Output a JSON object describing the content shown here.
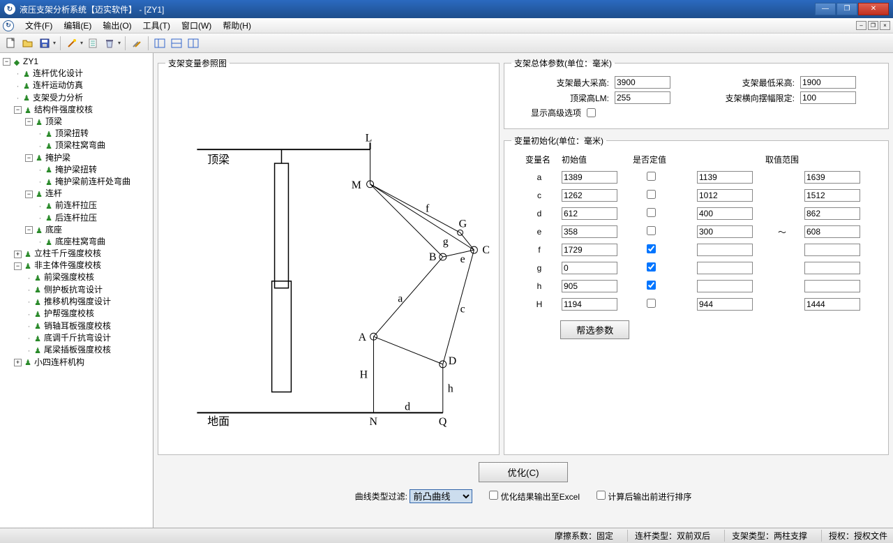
{
  "title": "液压支架分析系统【迈实软件】 - [ZY1]",
  "menus": [
    "文件(F)",
    "编辑(E)",
    "输出(O)",
    "工具(T)",
    "窗口(W)",
    "帮助(H)"
  ],
  "tree": {
    "root": "ZY1",
    "n1": "连杆优化设计",
    "n2": "连杆运动仿真",
    "n3": "支架受力分析",
    "n4": "结构件强度校核",
    "n4a": "顶梁",
    "n4a1": "顶梁扭转",
    "n4a2": "顶梁柱窝弯曲",
    "n4b": "掩护梁",
    "n4b1": "掩护梁扭转",
    "n4b2": "掩护梁前连杆处弯曲",
    "n4c": "连杆",
    "n4c1": "前连杆拉压",
    "n4c2": "后连杆拉压",
    "n4d": "底座",
    "n4d1": "底座柱窝弯曲",
    "n5": "立柱千斤强度校核",
    "n6": "非主体件强度校核",
    "n6a": "前梁强度校核",
    "n6b": "侧护板抗弯设计",
    "n6c": "推移机构强度设计",
    "n6d": "护帮强度校核",
    "n6e": "销轴耳板强度校核",
    "n6f": "底调千斤抗弯设计",
    "n6g": "尾梁插板强度校核",
    "n7": "小四连杆机构"
  },
  "groupbox": {
    "diagram": "支架变量参照图",
    "overall": "支架总体参数(单位：毫米)",
    "init": "变量初始化(单位：毫米)"
  },
  "overall": {
    "maxH_label": "支架最大采高:",
    "maxH": "3900",
    "minH_label": "支架最低采高:",
    "minH": "1900",
    "beamH_label": "顶梁高LM:",
    "beamH": "255",
    "swing_label": "支架横向摆幅限定:",
    "swing": "100",
    "advanced_label": "显示高级选项"
  },
  "vars_header": {
    "name": "变量名",
    "init": "初始值",
    "fixed": "是否定值",
    "range": "取值范围"
  },
  "vars": [
    {
      "n": "a",
      "v": "1389",
      "f": false,
      "lo": "1139",
      "hi": "1639"
    },
    {
      "n": "c",
      "v": "1262",
      "f": false,
      "lo": "1012",
      "hi": "1512"
    },
    {
      "n": "d",
      "v": "612",
      "f": false,
      "lo": "400",
      "hi": "862"
    },
    {
      "n": "e",
      "v": "358",
      "f": false,
      "lo": "300",
      "hi": "608"
    },
    {
      "n": "f",
      "v": "1729",
      "f": true,
      "lo": "",
      "hi": ""
    },
    {
      "n": "g",
      "v": "0",
      "f": true,
      "lo": "",
      "hi": ""
    },
    {
      "n": "h",
      "v": "905",
      "f": true,
      "lo": "",
      "hi": ""
    },
    {
      "n": "H",
      "v": "1194",
      "f": false,
      "lo": "944",
      "hi": "1444"
    }
  ],
  "buttons": {
    "help_params": "帮选参数",
    "optimize": "优化(C)"
  },
  "filter": {
    "label": "曲线类型过滤:",
    "selected": "前凸曲线",
    "excel": "优化结果输出至Excel",
    "sort": "计算后输出前进行排序"
  },
  "status": {
    "friction": "摩擦系数：固定",
    "link": "连杆类型：双前双后",
    "support": "支架类型：两柱支撑",
    "auth": "授权：授权文件"
  },
  "diagram_labels": {
    "top": "顶梁",
    "ground": "地面",
    "L": "L",
    "M": "M",
    "G": "G",
    "C": "C",
    "B": "B",
    "A": "A",
    "H": "H",
    "N": "N",
    "Q": "Q",
    "D": "D",
    "a": "a",
    "c": "c",
    "d": "d",
    "e": "e",
    "f": "f",
    "g": "g",
    "h": "h"
  }
}
